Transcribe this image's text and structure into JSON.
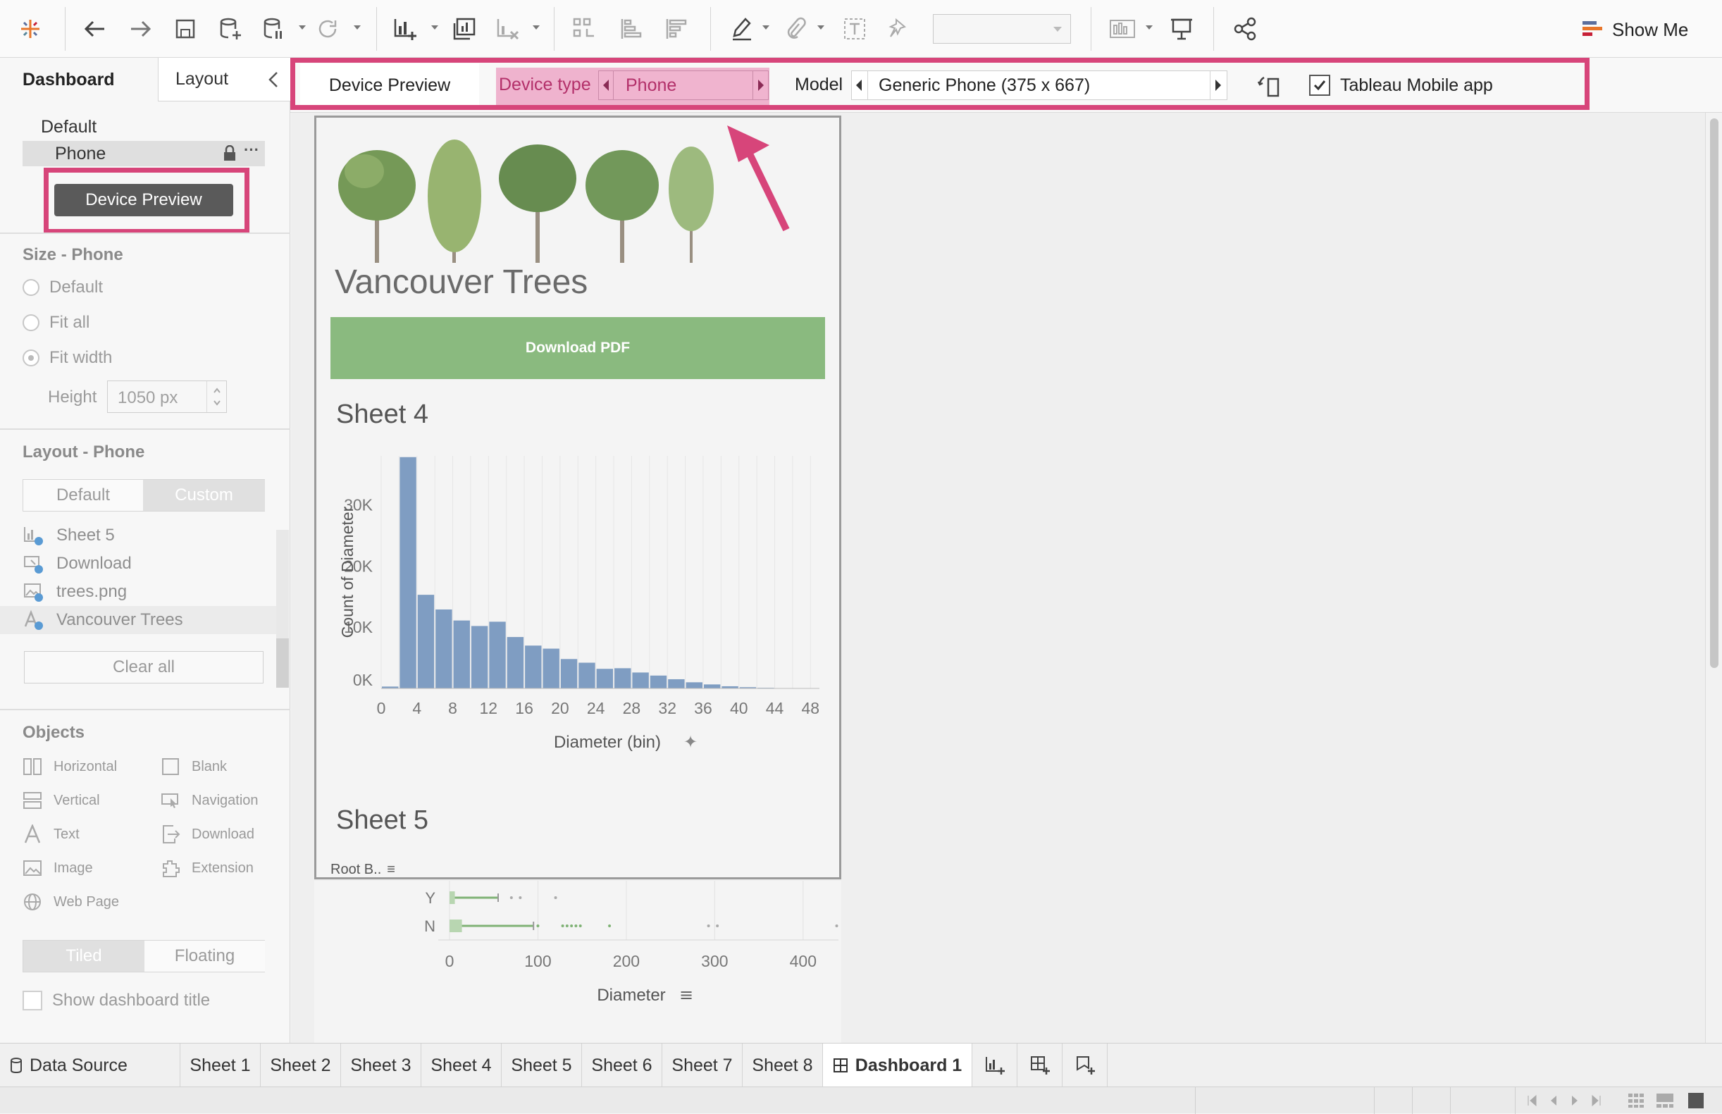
{
  "toolbar": {
    "icons": [
      "tableau-logo-icon",
      "undo-icon",
      "redo-icon",
      "save-icon",
      "new-datasource-icon",
      "pause-updates-icon",
      "refresh-icon",
      "new-worksheet-icon",
      "duplicate-sheet-icon",
      "clear-sheet-icon",
      "swap-icon",
      "sort-ascending-icon",
      "sort-descending-icon",
      "highlight-icon",
      "group-icon",
      "labels-icon",
      "fix-axes-icon",
      "fit-icon",
      "presentation-icon",
      "share-icon"
    ],
    "show_me_label": "Show Me"
  },
  "left_panel": {
    "tabs": {
      "dashboard": "Dashboard",
      "layout": "Layout"
    },
    "device_list": {
      "default_label": "Default",
      "phone_label": "Phone",
      "more": "···"
    },
    "device_preview_button": "Device Preview",
    "size": {
      "title": "Size - Phone",
      "options": [
        "Default",
        "Fit all",
        "Fit width"
      ],
      "selected": "Fit width",
      "height_label": "Height",
      "height_value": "1050 px"
    },
    "layout": {
      "title": "Layout - Phone",
      "toggle": [
        "Default",
        "Custom"
      ],
      "active": "Custom",
      "items": [
        "Sheet 5",
        "Download",
        "trees.png",
        "Vancouver Trees"
      ],
      "clear_all": "Clear all"
    },
    "objects": {
      "title": "Objects",
      "items": [
        "Horizontal",
        "Blank",
        "Vertical",
        "Navigation",
        "Text",
        "Download",
        "Image",
        "Extension",
        "Web Page"
      ],
      "tiled_floating": [
        "Tiled",
        "Floating"
      ],
      "active": "Tiled",
      "show_title_label": "Show dashboard title"
    }
  },
  "preview_bar": {
    "tab_label": "Device Preview",
    "device_type_label": "Device type",
    "device_type_value": "Phone",
    "model_label": "Model",
    "model_value": "Generic Phone (375 x 667)",
    "mobile_app_label": "Tableau Mobile app",
    "mobile_app_checked": true,
    "highlight_color": "#d7457a"
  },
  "dashboard": {
    "title": "Vancouver Trees",
    "download_button": "Download PDF",
    "button_color": "#8aba7f",
    "sheet4_title": "Sheet 4",
    "sheet5_title": "Sheet 5",
    "sheet5_header": "Root B..",
    "pin_icon": "pin-icon",
    "sort_icon": "sort-icon"
  },
  "chart_data": [
    {
      "type": "bar",
      "title": "Sheet 4",
      "xlabel": "Diameter (bin)",
      "ylabel": "Count of Diameter",
      "x_ticks": [
        "0",
        "4",
        "8",
        "12",
        "16",
        "20",
        "24",
        "28",
        "32",
        "36",
        "40",
        "44",
        "48"
      ],
      "y_ticks": [
        "0K",
        "10K",
        "20K",
        "30K"
      ],
      "ylim": [
        0,
        38000
      ],
      "xlim": [
        0,
        49
      ],
      "bin_width": 2,
      "bins": [
        0,
        2,
        4,
        6,
        8,
        10,
        12,
        14,
        16,
        18,
        20,
        22,
        24,
        26,
        28,
        30,
        32,
        34,
        36,
        38,
        40,
        42,
        44,
        46
      ],
      "values": [
        300,
        37800,
        15300,
        12900,
        11100,
        10200,
        10900,
        8400,
        7000,
        6500,
        4800,
        4200,
        3200,
        3300,
        2600,
        2100,
        1500,
        1000,
        650,
        350,
        200,
        100,
        50,
        20
      ],
      "bar_color": "#7f9dc2",
      "grid": true
    },
    {
      "type": "box",
      "title": "Sheet 5",
      "xlabel": "Diameter",
      "categories": [
        "Y",
        "N"
      ],
      "x_ticks": [
        "0",
        "100",
        "200",
        "300",
        "400"
      ],
      "xlim": [
        0,
        440
      ],
      "color": "#7fb275"
    }
  ],
  "sheet_tabs": {
    "data_source": "Data Source",
    "sheets": [
      "Sheet 1",
      "Sheet 2",
      "Sheet 3",
      "Sheet 4",
      "Sheet 5",
      "Sheet 6",
      "Sheet 7",
      "Sheet 8"
    ],
    "active": "Dashboard 1"
  }
}
